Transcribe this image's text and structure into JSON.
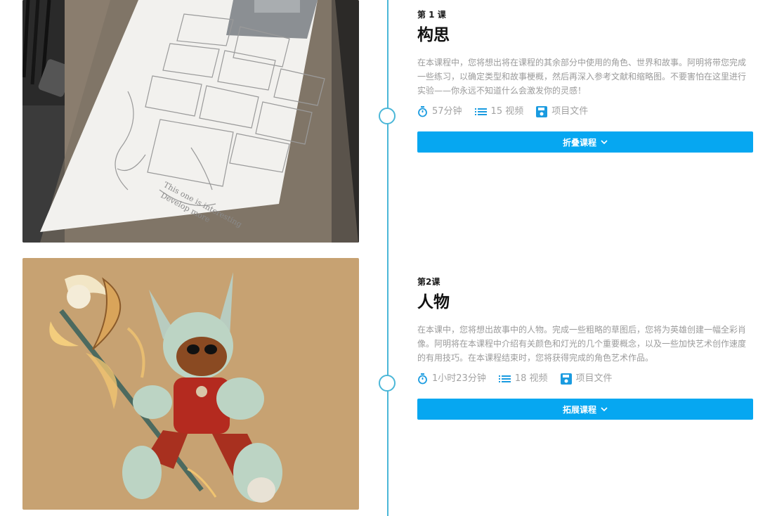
{
  "lessons": [
    {
      "number": "第 1 课",
      "title": "构思",
      "description": "在本课程中，您将想出将在课程的其余部分中使用的角色、世界和故事。阿明将带您完成一些练习，以确定类型和故事梗概，然后再深入参考文献和缩略图。不要害怕在这里进行实验——你永远不知道什么会激发你的灵感！",
      "duration": "57分钟",
      "videos": "15 视频",
      "files": "项目文件",
      "button_label": "折叠课程",
      "image_icon": "storyboard-sketch-photo"
    },
    {
      "number": "第2课",
      "title": "人物",
      "description": "在本课中，您将想出故事中的人物。完成一些粗略的草图后，您将为英雄创建一幅全彩肖像。阿明将在本课程中介绍有关颜色和灯光的几个重要概念，以及一些加快艺术创作速度的有用技巧。在本课程结束时，您将获得完成的角色艺术作品。",
      "duration": "1小时23分钟",
      "videos": "18 视频",
      "files": "项目文件",
      "button_label": "拓展课程",
      "image_icon": "robot-character-illustration"
    }
  ],
  "colors": {
    "accent": "#06a7f1",
    "timeline": "#4bb7d8",
    "meta_icon": "#1a9be0",
    "muted_text": "#9b9b9b"
  },
  "icons": [
    "stopwatch-icon",
    "list-icon",
    "save-icon",
    "chevron-down-icon"
  ]
}
